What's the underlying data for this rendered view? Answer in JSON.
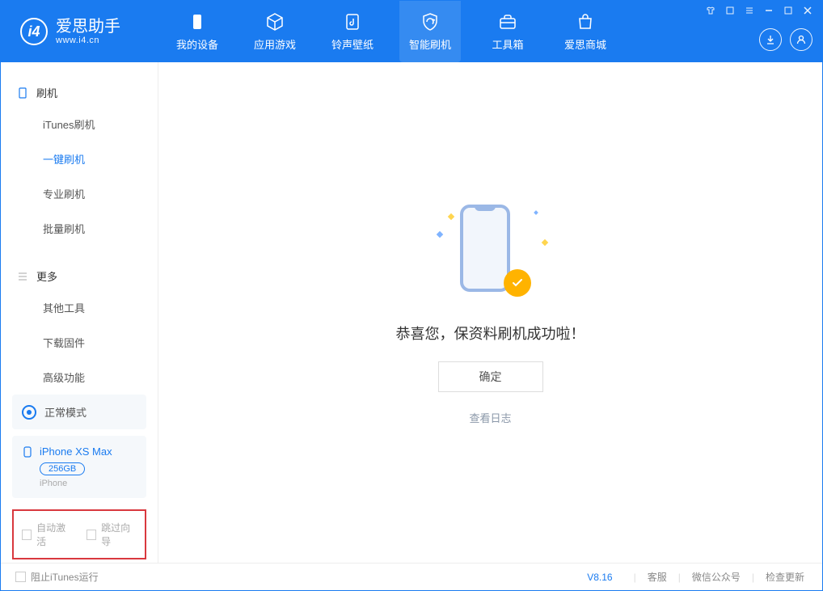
{
  "app": {
    "name": "爱思助手",
    "url": "www.i4.cn",
    "version": "V8.16"
  },
  "tabs": [
    {
      "label": "我的设备"
    },
    {
      "label": "应用游戏"
    },
    {
      "label": "铃声壁纸"
    },
    {
      "label": "智能刷机"
    },
    {
      "label": "工具箱"
    },
    {
      "label": "爱思商城"
    }
  ],
  "sidebar": {
    "sec1_title": "刷机",
    "sec1_items": [
      "iTunes刷机",
      "一键刷机",
      "专业刷机",
      "批量刷机"
    ],
    "sec2_title": "更多",
    "sec2_items": [
      "其他工具",
      "下载固件",
      "高级功能"
    ],
    "mode": "正常模式",
    "device": {
      "name": "iPhone XS Max",
      "capacity": "256GB",
      "type": "iPhone"
    },
    "opt_auto_activate": "自动激活",
    "opt_skip_guide": "跳过向导"
  },
  "main": {
    "success_msg": "恭喜您，保资料刷机成功啦！",
    "ok": "确定",
    "view_log": "查看日志"
  },
  "footer": {
    "block_itunes": "阻止iTunes运行",
    "support": "客服",
    "wechat": "微信公众号",
    "update": "检查更新"
  }
}
